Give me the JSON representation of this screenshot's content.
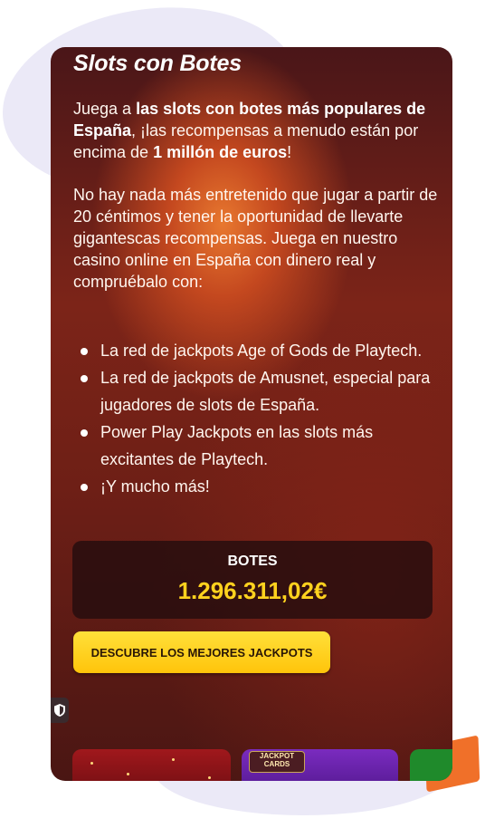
{
  "section": {
    "title": "Slots con Botes",
    "paragraph1": {
      "t1": "Juega a ",
      "b1": "las slots con botes más populares de España",
      "t2": ", ¡las recompensas a menudo están por encima de ",
      "b2": "1 millón de euros",
      "t3": "!"
    },
    "paragraph2": "No hay nada más entretenido que jugar a partir de 20 céntimos y tener la oportunidad de llevarte gigantescas recompensas. Juega en nuestro casino online en España con dinero real y compruébalo con:",
    "features": [
      "La red de jackpots Age of Gods de Playtech.",
      "La red de jackpots de Amusnet, especial para jugadores de slots de España.",
      "Power Play Jackpots en las slots más excitantes de Playtech.",
      "¡Y mucho más!"
    ]
  },
  "jackpot": {
    "label": "BOTES",
    "amount": "1.296.311,02€"
  },
  "cta": {
    "label": "DESCUBRE LOS MEJORES JACKPOTS"
  },
  "game_tiles": [
    {
      "logo_text": "JACKPOT CARDS"
    }
  ],
  "icons": {
    "privacy": "shield-icon"
  },
  "colors": {
    "accent": "#ffc40a",
    "jackpot_value": "#ffd21e",
    "brand_orange": "#f07029"
  }
}
